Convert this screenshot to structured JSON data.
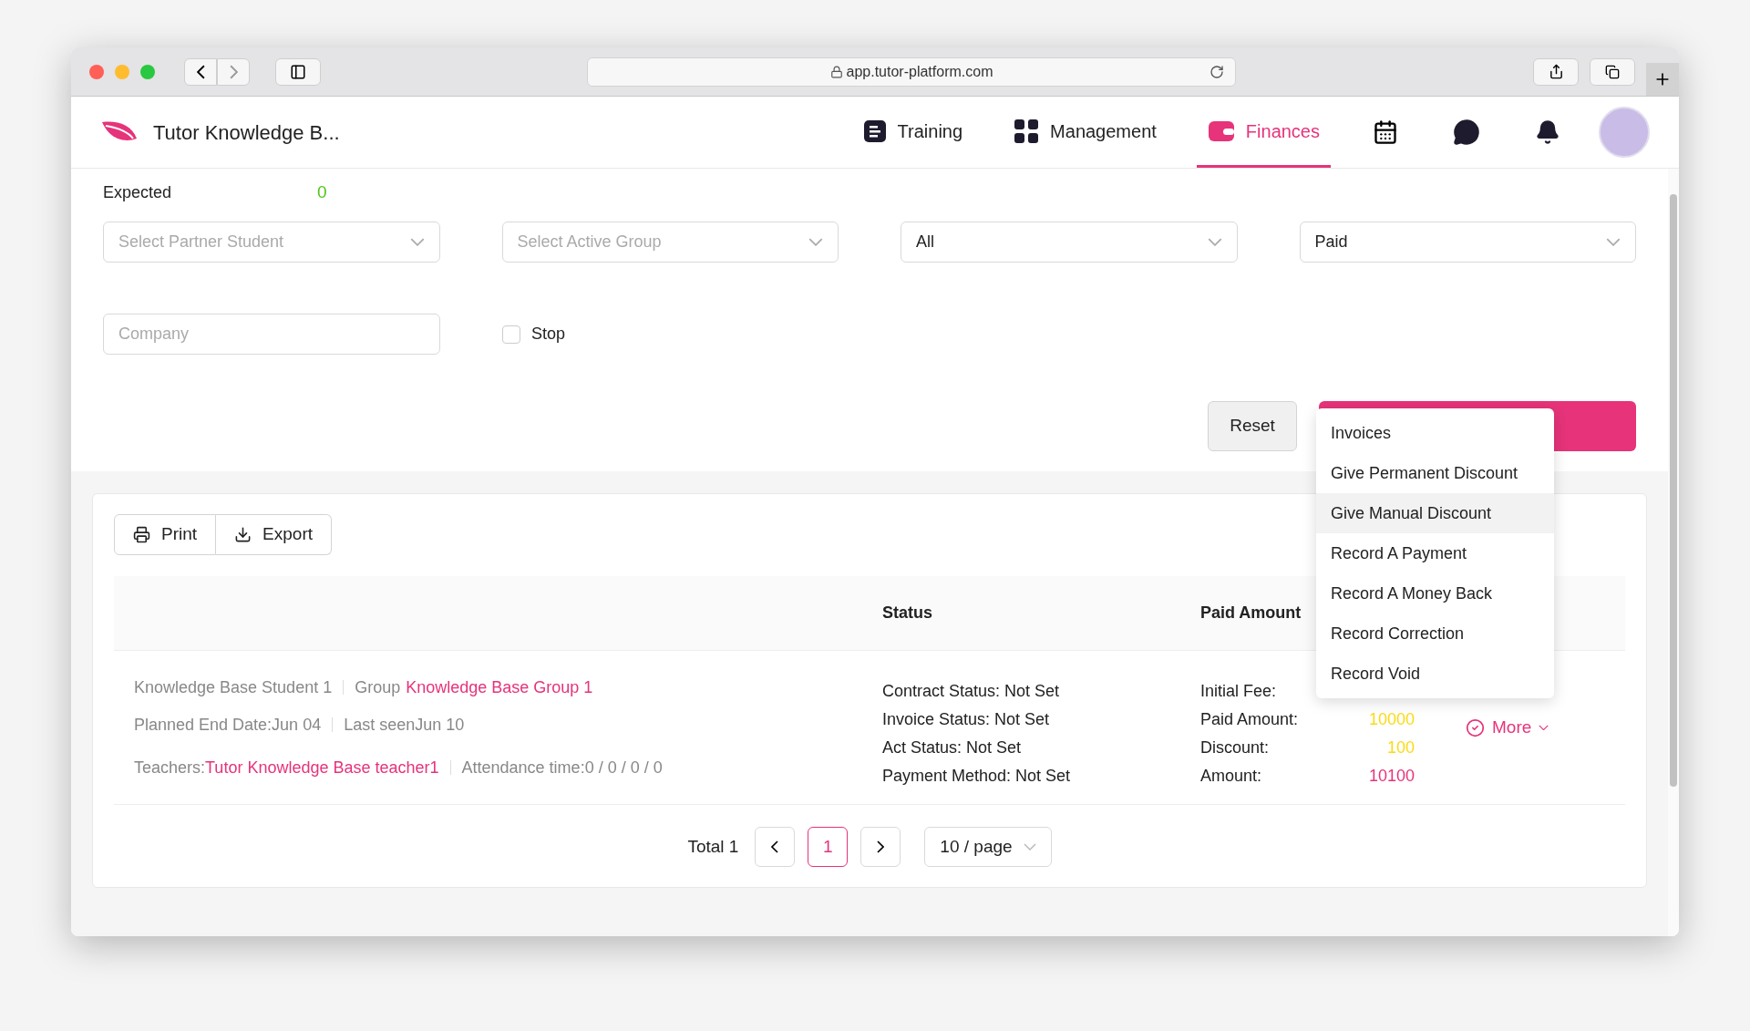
{
  "browser": {
    "url": "app.tutor-platform.com"
  },
  "header": {
    "title": "Tutor Knowledge B...",
    "nav": [
      {
        "label": "Training",
        "kind": "training",
        "selected": false
      },
      {
        "label": "Management",
        "kind": "management",
        "selected": false
      },
      {
        "label": "Finances",
        "kind": "finances",
        "selected": true
      }
    ]
  },
  "summary": {
    "label": "Expected",
    "value": "0"
  },
  "filters": {
    "selects": [
      {
        "placeholder": "Select Partner Student"
      },
      {
        "placeholder": "Select Active Group"
      },
      {
        "value": "All"
      },
      {
        "value": "Paid"
      }
    ],
    "company": {
      "placeholder": "Company"
    },
    "stop": {
      "label": "Stop",
      "checked": false
    },
    "reset": "Reset"
  },
  "menu": [
    {
      "label": "Invoices",
      "selected": false
    },
    {
      "label": "Give Permanent Discount",
      "selected": false
    },
    {
      "label": "Give Manual Discount",
      "selected": true
    },
    {
      "label": "Record A Payment",
      "selected": false
    },
    {
      "label": "Record A Money Back",
      "selected": false
    },
    {
      "label": "Record Correction",
      "selected": false
    },
    {
      "label": "Record Void",
      "selected": false
    }
  ],
  "toolbar": [
    "Print",
    "Export"
  ],
  "table": {
    "columns": [
      "Status",
      "Paid Amount"
    ],
    "rows": [
      {
        "student": "Knowledge Base Student 1",
        "group_label": "Group",
        "group": "Knowledge Base Group 1",
        "planned_end": "Planned End Date:Jun 04",
        "last_seen": "Last seenJun 10",
        "teachers_label": "Teachers:",
        "teacher": "Tutor Knowledge Base teacher1",
        "attendance": "Attendance time:0 / 0 / 0 / 0",
        "status": [
          "Contract Status: Not Set",
          "Invoice Status: Not Set",
          "Act Status: Not Set",
          "Payment Method: Not Set"
        ],
        "amounts": [
          {
            "label": "Initial Fee:"
          },
          {
            "label": "Paid Amount:",
            "value": "10000",
            "color": "#fadb14"
          },
          {
            "label": "Discount:",
            "value": "100",
            "color": "#fadb14"
          },
          {
            "label": "Amount:",
            "value": "10100",
            "color": "#e6337a"
          }
        ],
        "more": "More"
      }
    ]
  },
  "pagination": {
    "total": "Total 1",
    "pages": [
      {
        "label": "1",
        "selected": true
      }
    ],
    "page_size": "10 / page"
  }
}
